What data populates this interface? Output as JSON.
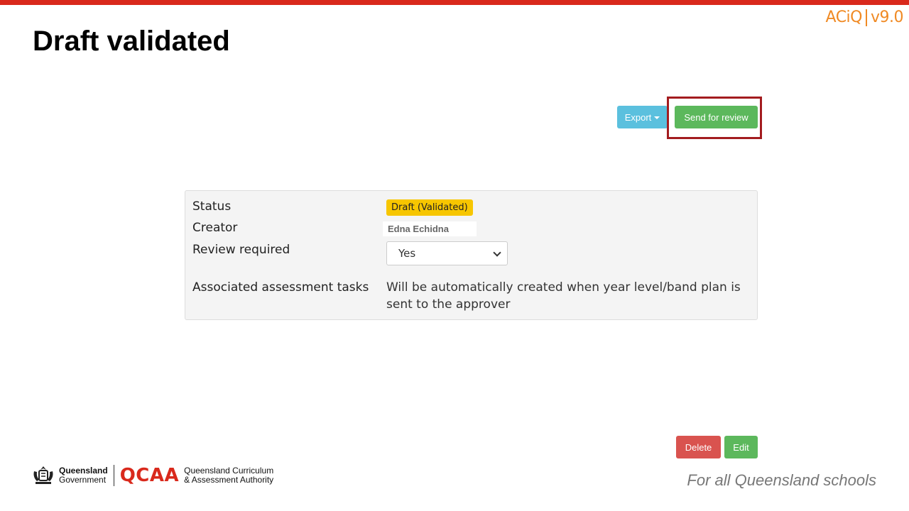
{
  "header": {
    "title": "Draft validated",
    "logo_aciq": "ACiQ",
    "logo_version": "v9.0"
  },
  "toolbar": {
    "export_label": "Export",
    "send_review_label": "Send for review"
  },
  "details": {
    "status_label": "Status",
    "status_value": "Draft (Validated)",
    "creator_label": "Creator",
    "creator_value": "Edna Echidna",
    "review_label": "Review required",
    "review_value": "Yes",
    "assoc_label": "Associated assessment tasks",
    "assoc_value": "Will be automatically created when year level/band plan is sent to the approver"
  },
  "actions": {
    "delete_label": "Delete",
    "edit_label": "Edit"
  },
  "footer": {
    "qgov_line1": "Queensland",
    "qgov_line2": "Government",
    "qcaa_logo": "QCAA",
    "qcaa_line1": "Queensland Curriculum",
    "qcaa_line2": "& Assessment Authority",
    "tagline": "For all Queensland schools"
  },
  "colors": {
    "brand_red": "#d9291c",
    "aciq_orange": "#f08a24",
    "info": "#5bc0de",
    "success": "#5cb85c",
    "danger": "#d9534f",
    "badge_yellow": "#f7c600",
    "highlight_box": "#a31c1f"
  }
}
